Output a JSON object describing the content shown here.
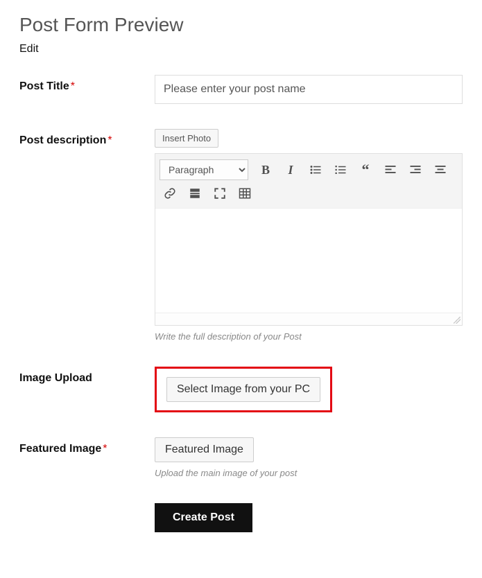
{
  "page": {
    "title": "Post Form Preview",
    "edit_link": "Edit"
  },
  "fields": {
    "title": {
      "label": "Post Title",
      "required": "*",
      "placeholder": "Please enter your post name"
    },
    "description": {
      "label": "Post description",
      "required": "*",
      "insert_photo_btn": "Insert Photo",
      "format_select": "Paragraph",
      "help": "Write the full description of your Post"
    },
    "image_upload": {
      "label": "Image Upload",
      "button": "Select Image from your PC"
    },
    "featured": {
      "label": "Featured Image",
      "required": "*",
      "button": "Featured Image",
      "help": "Upload the main image of your post"
    }
  },
  "submit": {
    "label": "Create Post"
  },
  "toolbar_icons": [
    "bold",
    "italic",
    "bullet-list",
    "numbered-list",
    "quote",
    "align-left",
    "align-right",
    "align-center",
    "link",
    "hr",
    "fullscreen",
    "table"
  ]
}
